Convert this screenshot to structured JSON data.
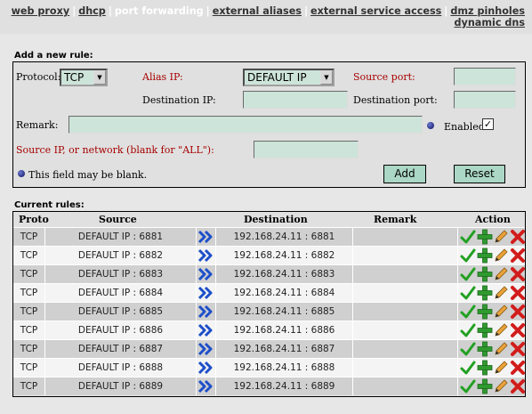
{
  "nav": {
    "line1": [
      {
        "label": "web proxy",
        "current": false
      },
      {
        "label": "dhcp",
        "current": false
      },
      {
        "label": "port forwarding",
        "current": true
      },
      {
        "label": "external aliases",
        "current": false
      },
      {
        "label": "external service access",
        "current": false
      },
      {
        "label": "dmz pinholes",
        "current": false
      }
    ],
    "line2": [
      {
        "label": "dynamic dns",
        "current": false
      }
    ]
  },
  "add_rule": {
    "title": "Add a new rule:",
    "protocol_label": "Protocol:",
    "protocol_value": "TCP",
    "alias_ip_label": "Alias IP:",
    "alias_ip_value": "DEFAULT IP",
    "source_port_label": "Source port:",
    "source_port_value": "",
    "destination_ip_label": "Destination IP:",
    "destination_ip_value": "",
    "destination_port_label": "Destination port:",
    "destination_port_value": "",
    "remark_label": "Remark:",
    "remark_value": "",
    "enabled_label": "Enabled:",
    "enabled_checked": true,
    "source_network_label": "Source IP, or network (blank for \"ALL\"):",
    "source_network_value": "",
    "blank_note": "This field may be blank.",
    "add_button": "Add",
    "reset_button": "Reset"
  },
  "current_rules": {
    "title": "Current rules:",
    "columns": {
      "proto": "Proto",
      "source": "Source",
      "destination": "Destination",
      "remark": "Remark",
      "action": "Action"
    },
    "rows": [
      {
        "proto": "TCP",
        "source": "DEFAULT IP : 6881",
        "destination": "192.168.24.11 : 6881",
        "remark": ""
      },
      {
        "proto": "TCP",
        "source": "DEFAULT IP : 6882",
        "destination": "192.168.24.11 : 6882",
        "remark": ""
      },
      {
        "proto": "TCP",
        "source": "DEFAULT IP : 6883",
        "destination": "192.168.24.11 : 6883",
        "remark": ""
      },
      {
        "proto": "TCP",
        "source": "DEFAULT IP : 6884",
        "destination": "192.168.24.11 : 6884",
        "remark": ""
      },
      {
        "proto": "TCP",
        "source": "DEFAULT IP : 6885",
        "destination": "192.168.24.11 : 6885",
        "remark": ""
      },
      {
        "proto": "TCP",
        "source": "DEFAULT IP : 6886",
        "destination": "192.168.24.11 : 6886",
        "remark": ""
      },
      {
        "proto": "TCP",
        "source": "DEFAULT IP : 6887",
        "destination": "192.168.24.11 : 6887",
        "remark": ""
      },
      {
        "proto": "TCP",
        "source": "DEFAULT IP : 6888",
        "destination": "192.168.24.11 : 6888",
        "remark": ""
      },
      {
        "proto": "TCP",
        "source": "DEFAULT IP : 6889",
        "destination": "192.168.24.11 : 6889",
        "remark": ""
      }
    ],
    "action_icons": [
      "check-icon",
      "plus-icon",
      "pencil-icon",
      "delete-x-icon"
    ]
  },
  "colors": {
    "field_bg": "#cde4da",
    "button_bg": "#abd7c6",
    "label_red": "#a60000",
    "row_odd": "#d0d0d0",
    "row_even": "#f4f4f4"
  }
}
